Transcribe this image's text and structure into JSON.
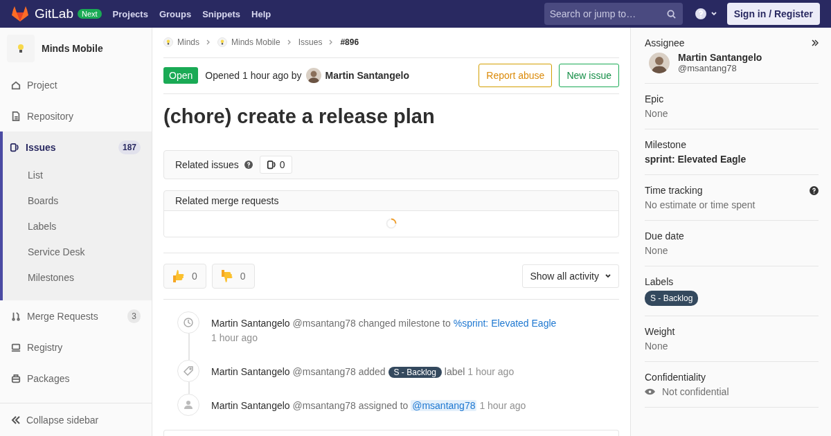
{
  "header": {
    "logo": "GitLab",
    "badge": "Next",
    "nav": [
      "Projects",
      "Groups",
      "Snippets",
      "Help"
    ],
    "search": {
      "placeholder": "Search or jump to…"
    },
    "sign_in": "Sign in / Register"
  },
  "sidebar": {
    "project": "Minds Mobile",
    "items": [
      {
        "label": "Project",
        "kind": "home",
        "selected": false
      },
      {
        "label": "Repository",
        "kind": "doc",
        "selected": false
      },
      {
        "label": "Issues",
        "kind": "issues",
        "count": "187",
        "selected": true,
        "children": [
          {
            "label": "List",
            "selected": false
          },
          {
            "label": "Boards",
            "selected": false
          },
          {
            "label": "Labels",
            "selected": false
          },
          {
            "label": "Service Desk",
            "selected": false
          },
          {
            "label": "Milestones",
            "selected": false
          }
        ]
      },
      {
        "label": "Merge Requests",
        "kind": "merge",
        "count": "3",
        "selected": false
      },
      {
        "label": "Registry",
        "kind": "registry",
        "selected": false
      },
      {
        "label": "Packages",
        "kind": "package",
        "selected": false
      }
    ],
    "collapse": "Collapse sidebar"
  },
  "breadcrumbs": [
    {
      "label": "Minds",
      "avatar": true
    },
    {
      "label": "Minds Mobile",
      "avatar": true
    },
    {
      "label": "Issues",
      "avatar": false
    },
    {
      "label": "#896",
      "avatar": false
    }
  ],
  "issue": {
    "status": "Open",
    "opened": "Opened 1 hour ago by",
    "author": "Martin Santangelo",
    "actions": [
      {
        "label": "Report abuse",
        "kind": "warning"
      },
      {
        "label": "New issue",
        "kind": "success"
      }
    ],
    "title": "(chore) create a release plan"
  },
  "related_issues": {
    "label": "Related issues",
    "count": "0"
  },
  "related_merge_requests": {
    "title": "Related merge requests",
    "loading": true
  },
  "awards": [
    {
      "kind": "thumbsup",
      "count": "0"
    },
    {
      "kind": "thumbsdown",
      "count": "0"
    }
  ],
  "activity_filter": "Show all activity",
  "activity": [
    {
      "kind": "milestone",
      "author": "Martin Santangelo",
      "handle": "@msantang78",
      "action": "changed milestone to",
      "target": {
        "kind": "link",
        "text": "%sprint: Elevated Eagle"
      },
      "time": "1 hour ago",
      "time_on_new_line": true
    },
    {
      "kind": "label",
      "author": "Martin Santangelo",
      "handle": "@msantang78",
      "action": "added",
      "target": {
        "kind": "label",
        "text": "S - Backlog"
      },
      "after": "label",
      "time": "1 hour ago",
      "time_on_new_line": false
    },
    {
      "kind": "assignee",
      "author": "Martin Santangelo",
      "handle": "@msantang78",
      "action": "assigned to",
      "target": {
        "kind": "mention",
        "text": "@msantang78"
      },
      "time": "1 hour ago",
      "time_on_new_line": false
    }
  ],
  "right_sidebar": [
    {
      "title": "Assignee",
      "kind": "user",
      "help": false,
      "name": "Martin Santangelo",
      "handle": "@msantang78"
    },
    {
      "title": "Epic",
      "kind": "muted",
      "help": false,
      "value": "None"
    },
    {
      "title": "Milestone",
      "kind": "bold",
      "help": false,
      "value": "sprint: Elevated Eagle"
    },
    {
      "title": "Time tracking",
      "kind": "muted",
      "value": "No estimate or time spent",
      "help": true
    },
    {
      "title": "Due date",
      "kind": "muted",
      "help": false,
      "value": "None"
    },
    {
      "title": "Labels",
      "kind": "label",
      "help": false,
      "value": "S - Backlog"
    },
    {
      "title": "Weight",
      "kind": "muted",
      "help": false,
      "value": "None"
    },
    {
      "title": "Confidentiality",
      "kind": "eye",
      "help": false,
      "value": "Not confidential"
    }
  ]
}
